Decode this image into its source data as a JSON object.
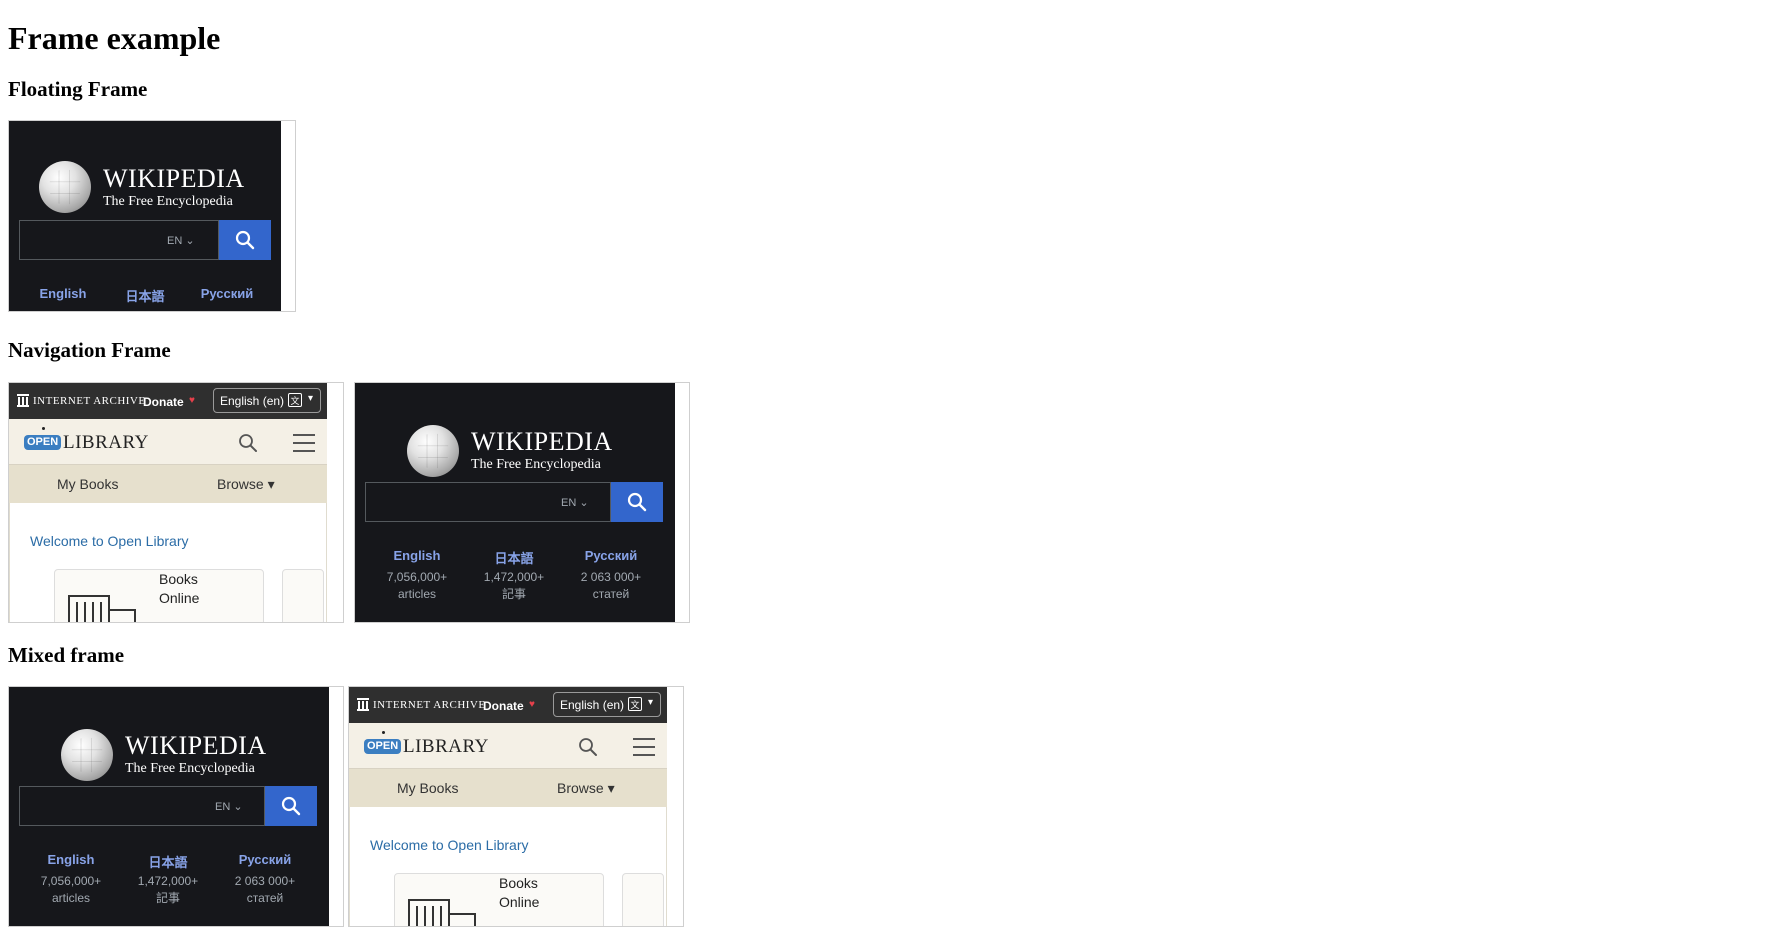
{
  "page": {
    "title": "Frame example",
    "sections": {
      "floating": "Floating Frame",
      "navigation": "Navigation Frame",
      "mixed": "Mixed frame"
    }
  },
  "wikipedia": {
    "wordmark": "WIKIPEDIA",
    "tagline": "The Free Encyclopedia",
    "language_selector": "EN",
    "languages": [
      {
        "name": "English",
        "count": "7,056,000+",
        "unit": "articles"
      },
      {
        "name": "日本語",
        "count": "1,472,000+",
        "unit": "記事"
      },
      {
        "name": "Русский",
        "count": "2 063 000+",
        "unit": "статей"
      }
    ]
  },
  "openlibrary": {
    "ia_label": "INTERNET ARCHIVE",
    "donate": "Donate",
    "language_button": "English (en)",
    "logo_badge": "OPEN",
    "logo_word": "LIBRARY",
    "nav": {
      "my_books": "My Books",
      "browse": "Browse ▾"
    },
    "welcome": "Welcome to Open Library",
    "card_line1": "Books",
    "card_line2": "Online"
  },
  "colors": {
    "wiki_bg": "#16171b",
    "wiki_link": "#88a3e8",
    "wiki_search_button": "#3366cc",
    "ol_header_bg": "#f4f0e6",
    "ol_nav_bg": "#e6e0cd",
    "ol_link": "#2b6ca6"
  }
}
